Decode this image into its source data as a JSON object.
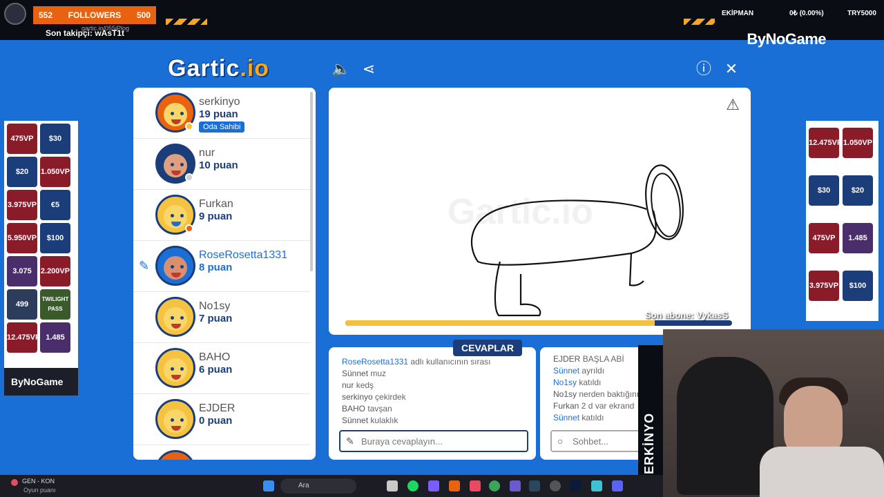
{
  "overlay": {
    "followers_current": "552",
    "followers_label": "FOLLOWERS",
    "followers_goal": "500",
    "last_follower": "Son takipçi: wAsT1t",
    "url": "gartic.io/055jPlog",
    "ekipman_label": "EKİPMAN",
    "ekipman_value": "0₺ (0.00%)",
    "try_label": "TRY5000",
    "brand": "ByNoGame",
    "last_sub": "Son abone: VykasS"
  },
  "header": {
    "logo_main": "Gartic",
    "logo_suffix": ".io"
  },
  "players": [
    {
      "name": "serkinyo",
      "score": "19 puan",
      "badge": "Oda Sahibi",
      "dot": "#f5c13c"
    },
    {
      "name": "nur",
      "score": "10 puan",
      "dot": "#cfcfcf"
    },
    {
      "name": "Furkan",
      "score": "9 puan",
      "dot": "#e8620f"
    },
    {
      "name": "RoseRosetta1331",
      "score": "8 puan",
      "drawing": true
    },
    {
      "name": "No1sy",
      "score": "7 puan"
    },
    {
      "name": "BAHO",
      "score": "6 puan"
    },
    {
      "name": "EJDER",
      "score": "0 puan"
    }
  ],
  "canvas": {
    "time_progress": 0.8
  },
  "answers": {
    "title": "CEVAPLAR",
    "lines": [
      {
        "user": "RoseRosetta1331",
        "text": "adlı kullanıcının sırası",
        "system": true
      },
      {
        "user": "Sünnet",
        "text": "muz"
      },
      {
        "user": "nur",
        "text": "kedş"
      },
      {
        "user": "serkinyo",
        "text": "çekirdek"
      },
      {
        "user": "BAHO",
        "text": "tavşan"
      },
      {
        "user": "Sünnet",
        "text": "kulaklık"
      }
    ],
    "placeholder": "Buraya cevaplayın..."
  },
  "chat": {
    "lines": [
      {
        "user": "EJDER",
        "text": "BAŞLA ABİ"
      },
      {
        "user": "Sünnet",
        "text": "ayrıldı",
        "system": true
      },
      {
        "user": "No1sy",
        "text": "katıldı",
        "system": true
      },
      {
        "user": "No1sy",
        "text": "nerden baktığını ere"
      },
      {
        "user": "Furkan",
        "text": "2 d var ekrand"
      },
      {
        "user": "Sünnet",
        "text": "katıldı",
        "system": true
      }
    ],
    "placeholder": "Sohbet..."
  },
  "ads_left": [
    "475VP",
    "$30",
    "$20",
    "1.050VP",
    "3.975VP",
    "€5",
    "5.950VP",
    "$100",
    "3.075",
    "2.200VP",
    "499",
    "TWILIGHT PASS",
    "12.475VP",
    "1.485"
  ],
  "ads_right": [
    "12.475VP",
    "1.050VP",
    "$30",
    "$20",
    "475VP",
    "1.485",
    "3.975VP",
    "$100"
  ],
  "ad_brand": "ByNoGame",
  "streamer": "SERKİNYO",
  "taskbar": {
    "group": "GEN - KON",
    "sub": "Oyun puanı",
    "search": "Ara"
  }
}
